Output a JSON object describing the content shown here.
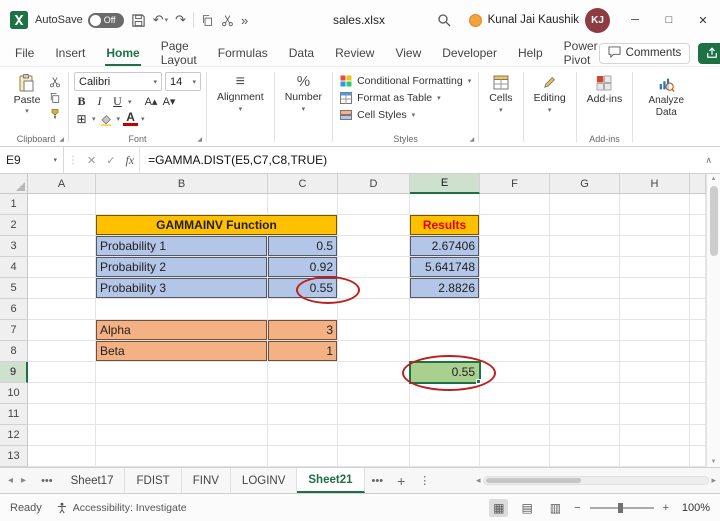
{
  "colors": {
    "excel_green": "#1E7145",
    "gold_fill": "#FFC000",
    "blue_fill": "#B4C6E7",
    "orange_fill": "#F4B183",
    "green_fill": "#A9D08E",
    "results_text": "#E00000",
    "annotation_red": "#BE1E1E"
  },
  "titlebar": {
    "autosave_label": "AutoSave",
    "autosave_state": "Off",
    "filename": "sales.xlsx",
    "user_name": "Kunal Jai Kaushik",
    "user_initials": "KJ"
  },
  "menubar": {
    "tabs": [
      {
        "label": "File",
        "active": false
      },
      {
        "label": "Insert",
        "active": false
      },
      {
        "label": "Home",
        "active": true
      },
      {
        "label": "Page Layout",
        "active": false
      },
      {
        "label": "Formulas",
        "active": false
      },
      {
        "label": "Data",
        "active": false
      },
      {
        "label": "Review",
        "active": false
      },
      {
        "label": "View",
        "active": false
      },
      {
        "label": "Developer",
        "active": false
      },
      {
        "label": "Help",
        "active": false
      },
      {
        "label": "Power Pivot",
        "active": false
      }
    ],
    "comments_label": "Comments"
  },
  "ribbon": {
    "paste": "Paste",
    "clipboard_group": "Clipboard",
    "font_name": "Calibri",
    "font_size": "14",
    "font_group": "Font",
    "alignment_label": "Alignment",
    "number_label": "Number",
    "conditional_formatting": "Conditional Formatting",
    "format_as_table": "Format as Table",
    "cell_styles": "Cell Styles",
    "styles_group": "Styles",
    "cells_label": "Cells",
    "editing_label": "Editing",
    "addins_label": "Add-ins",
    "addins_group": "Add-ins",
    "analyze_data_label": "Analyze Data"
  },
  "formula_bar": {
    "name_box": "E9",
    "fx": "fx",
    "formula": "=GAMMA.DIST(E5,C7,C8,TRUE)"
  },
  "grid": {
    "columns": [
      "A",
      "B",
      "C",
      "D",
      "E",
      "F",
      "G",
      "H"
    ],
    "row_count": 13,
    "selected_column": "E",
    "selected_row": "9",
    "cells": [
      {
        "ref": "B2",
        "text": "GAMMAINV Function",
        "fill": "gold",
        "align": "center",
        "bold": true,
        "span": 2
      },
      {
        "ref": "B3",
        "text": "Probability 1",
        "fill": "blue",
        "align": "left"
      },
      {
        "ref": "C3",
        "text": "0.5",
        "fill": "blue",
        "align": "right"
      },
      {
        "ref": "B4",
        "text": "Probability 2",
        "fill": "blue",
        "align": "left"
      },
      {
        "ref": "C4",
        "text": "0.92",
        "fill": "blue",
        "align": "right"
      },
      {
        "ref": "B5",
        "text": "Probability 3",
        "fill": "blue",
        "align": "left"
      },
      {
        "ref": "C5",
        "text": "0.55",
        "fill": "blue",
        "align": "right"
      },
      {
        "ref": "B7",
        "text": "Alpha",
        "fill": "orange",
        "align": "left"
      },
      {
        "ref": "C7",
        "text": "3",
        "fill": "orange",
        "align": "right"
      },
      {
        "ref": "B8",
        "text": "Beta",
        "fill": "orange",
        "align": "left"
      },
      {
        "ref": "C8",
        "text": "1",
        "fill": "orange",
        "align": "right"
      },
      {
        "ref": "E2",
        "text": "Results",
        "fill": "gold",
        "align": "center",
        "bold": true,
        "color": "red"
      },
      {
        "ref": "E3",
        "text": "2.67406",
        "fill": "blue",
        "align": "right"
      },
      {
        "ref": "E4",
        "text": "5.641748",
        "fill": "blue",
        "align": "right"
      },
      {
        "ref": "E5",
        "text": "2.8826",
        "fill": "blue",
        "align": "right"
      },
      {
        "ref": "E9",
        "text": "0.55",
        "fill": "green",
        "align": "right",
        "selected": true
      }
    ]
  },
  "annotations": {
    "circled": [
      "C5",
      "E9"
    ]
  },
  "sheet_tabs": {
    "tabs": [
      {
        "label": "Sheet17",
        "active": false
      },
      {
        "label": "FDIST",
        "active": false
      },
      {
        "label": "FINV",
        "active": false
      },
      {
        "label": "LOGINV",
        "active": false
      },
      {
        "label": "Sheet21",
        "active": true
      }
    ]
  },
  "status_bar": {
    "ready": "Ready",
    "accessibility": "Accessibility: Investigate",
    "zoom": "100%"
  },
  "icons": {
    "dropdown": "▾",
    "undo": "↶",
    "redo": "↷",
    "more_commands": "»",
    "minimize": "─",
    "maximize": "□",
    "close": "✕",
    "cancel": "✕",
    "enter": "✓",
    "ellipsis_v": "⋮",
    "ellipsis_h": "•••",
    "bold": "B",
    "italic": "I",
    "underline": "U",
    "increase_font": "A▴",
    "decrease_font": "A▾",
    "borders": "⊞",
    "font_color": "A",
    "align": "≡",
    "percent": "%",
    "collapse_formula": "∧",
    "scroll_up": "▲",
    "scroll_down": "▼",
    "nav_left": "◂",
    "nav_right": "▸",
    "add_sheet": "+",
    "view_normal": "▦",
    "view_layout": "▤",
    "view_break": "▥",
    "zoom_out": "−",
    "zoom_in": "+",
    "dialog_launcher": "◢"
  }
}
